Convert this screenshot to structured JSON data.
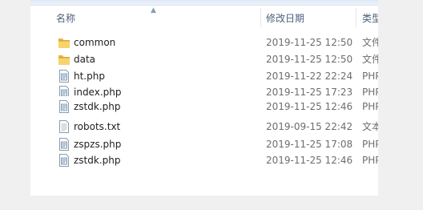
{
  "columns": {
    "name": "名称",
    "modified": "修改日期",
    "type": "类型"
  },
  "files": [
    {
      "name": "common",
      "modified": "2019-11-25 12:50",
      "type": "文件夹",
      "icon": "folder-icon"
    },
    {
      "name": "data",
      "modified": "2019-11-25 12:50",
      "type": "文件夹",
      "icon": "folder-icon"
    },
    {
      "name": "ht.php",
      "modified": "2019-11-22 22:24",
      "type": "PHP",
      "icon": "php-file-icon"
    },
    {
      "name": "index.php",
      "modified": "2019-11-25 17:23",
      "type": "PHP",
      "icon": "php-file-icon"
    },
    {
      "name": "zstdk.php",
      "modified": "2019-11-25 12:46",
      "type": "PHP",
      "icon": "php-file-icon"
    },
    {
      "name": "robots.txt",
      "modified": "2019-09-15 22:42",
      "type": "文本",
      "icon": "text-file-icon"
    },
    {
      "name": "zspzs.php",
      "modified": "2019-11-25 17:08",
      "type": "PHP",
      "icon": "php-file-icon"
    },
    {
      "name": "zstdk.php",
      "modified": "2019-11-25 12:46",
      "type": "PHP",
      "icon": "php-file-icon"
    }
  ]
}
